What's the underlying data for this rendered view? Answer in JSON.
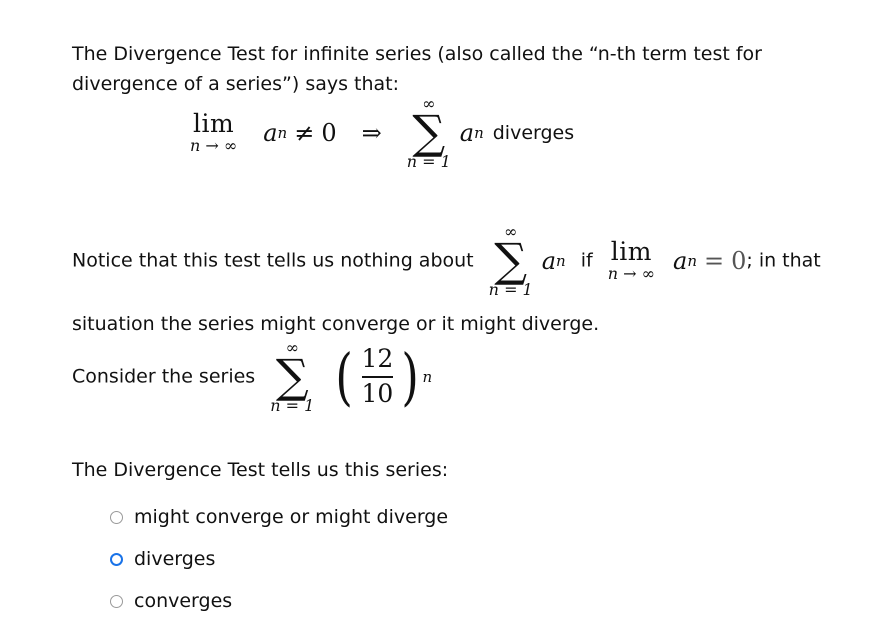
{
  "document": {
    "paragraph_intro": "The Divergence Test for infinite series (also called the “n-th term test for divergence of a series”) says that:",
    "paragraph_notice_before": "Notice that this test tells us nothing about",
    "paragraph_notice_middle": "if",
    "paragraph_notice_after": "; in that",
    "paragraph_notice_line2": "situation the series might converge or it might diverge.",
    "paragraph_consider": "Consider the series",
    "paragraph_question": "The Divergence Test tells us this series:"
  },
  "math": {
    "display_equation_1": {
      "limit_word": "lim",
      "limit_sub": "n → ∞",
      "term": "a",
      "term_index": "n",
      "relation": "≠",
      "relation_value": "0",
      "implies": "⇒",
      "sigma": "∑",
      "sigma_upper": "∞",
      "sigma_lower": "n = 1",
      "sum_term": "a",
      "sum_term_index": "n",
      "conclusion": "diverges"
    },
    "inline_sum": {
      "sigma": "∑",
      "sigma_upper": "∞",
      "sigma_lower": "n = 1",
      "term": "a",
      "term_index": "n"
    },
    "inline_limit": {
      "limit_word": "lim",
      "limit_sub": "n → ∞",
      "term": "a",
      "term_index": "n",
      "relation": "=",
      "relation_value": "0"
    },
    "series_expression": {
      "sigma": "∑",
      "sigma_upper": "∞",
      "sigma_lower": "n = 1",
      "paren_open": "(",
      "numerator": "12",
      "denominator": "10",
      "paren_close": ")",
      "exponent": "n"
    }
  },
  "options": {
    "items": [
      {
        "label": "might converge or might diverge",
        "state": "unselected"
      },
      {
        "label": "diverges",
        "state": "focused"
      },
      {
        "label": "converges",
        "state": "unselected"
      }
    ]
  },
  "colors": {
    "text": "#111111",
    "radio_unselected": "#9a9a9a",
    "radio_focus_ring": "#1a73e8",
    "background": "#ffffff",
    "faded_math": "#555555"
  }
}
